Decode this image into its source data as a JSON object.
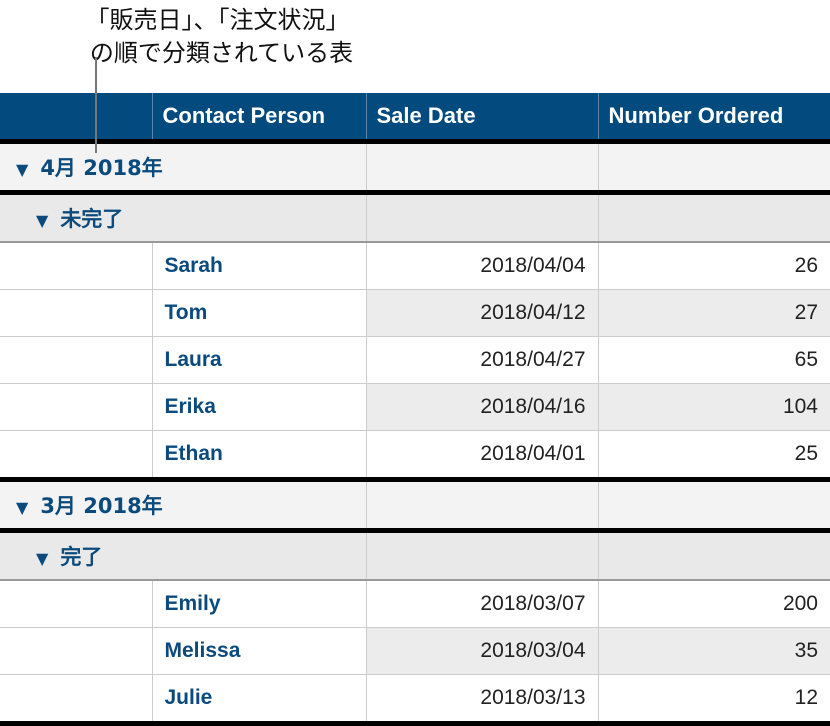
{
  "callout": {
    "line1": "「販売日」、「注文状況」",
    "line2": "の順で分類されている表"
  },
  "table": {
    "headers": [
      "",
      "Contact Person",
      "Sale Date",
      "Number Ordered"
    ],
    "groups": [
      {
        "label": "4月 2018年",
        "subgroups": [
          {
            "label": "未完了",
            "rows": [
              {
                "name": "Sarah",
                "date": "2018/04/04",
                "number": "26"
              },
              {
                "name": "Tom",
                "date": "2018/04/12",
                "number": "27"
              },
              {
                "name": "Laura",
                "date": "2018/04/27",
                "number": "65"
              },
              {
                "name": "Erika",
                "date": "2018/04/16",
                "number": "104"
              },
              {
                "name": "Ethan",
                "date": "2018/04/01",
                "number": "25"
              }
            ]
          }
        ]
      },
      {
        "label": "3月 2018年",
        "subgroups": [
          {
            "label": "完了",
            "rows": [
              {
                "name": "Emily",
                "date": "2018/03/07",
                "number": "200"
              },
              {
                "name": "Melissa",
                "date": "2018/03/04",
                "number": "35"
              },
              {
                "name": "Julie",
                "date": "2018/03/13",
                "number": "12"
              }
            ]
          }
        ]
      }
    ]
  },
  "icons": {
    "disclosure": "▼"
  },
  "colors": {
    "header_bg": "#034b7f",
    "accent_text": "#0b4a7c"
  }
}
